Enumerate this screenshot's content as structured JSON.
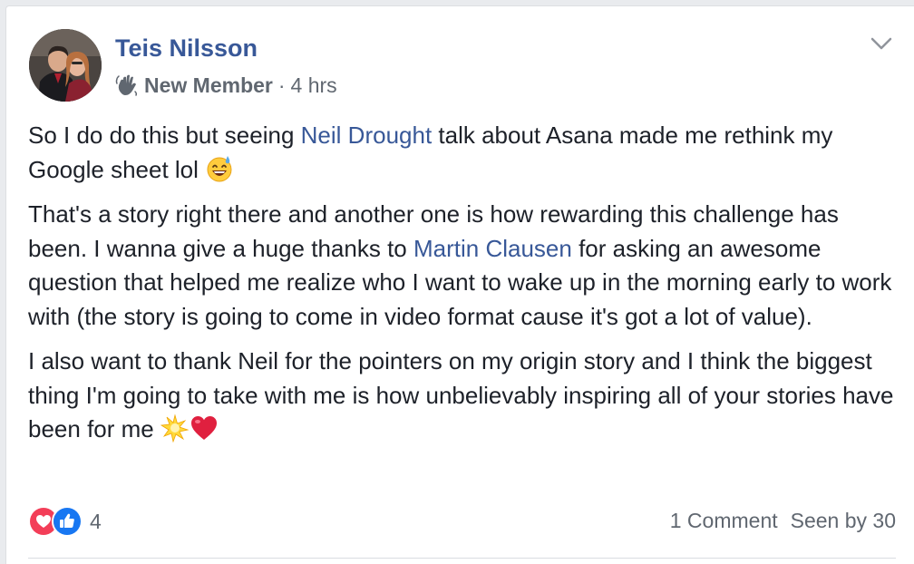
{
  "post": {
    "author_name": "Teis Nilsson",
    "badge_label": "New Member",
    "dot": "·",
    "time": "4 hrs",
    "paragraph1": {
      "text_a": "So I do do this but seeing ",
      "mention": "Neil Drought",
      "text_b": " talk about Asana made me rethink my Google sheet lol "
    },
    "paragraph2": {
      "text_a": "That's a story right there and another one is how rewarding this challenge has been. I wanna give a huge thanks to ",
      "mention": "Martin Clausen",
      "text_b": " for asking an awesome question that helped me realize who I want to wake up in the morning early to work with (the story is going to come in video format cause it's got a lot of value)."
    },
    "paragraph3": {
      "text_a": "I also want to thank Neil for the pointers on my origin story and I think the biggest thing I'm going to take with me is how unbelievably inspiring all of your stories have been for me "
    }
  },
  "footer": {
    "reaction_count": "4",
    "comments": "1 Comment",
    "seen_by": "Seen by 30"
  },
  "icons": {
    "badge": "waving-hand-icon",
    "menu": "chevron-down-icon",
    "emoji_1": "sweat-smile-emoji",
    "emoji_2": "glowing-star-emoji",
    "emoji_3": "red-heart-emoji",
    "reaction_1": "love-reaction-icon",
    "reaction_2": "like-reaction-icon"
  },
  "colors": {
    "link": "#385898",
    "text": "#1d2129",
    "secondary_text": "#606770",
    "background": "#e9ebee",
    "like_blue": "#1877f2",
    "love_red": "#f33e58"
  }
}
